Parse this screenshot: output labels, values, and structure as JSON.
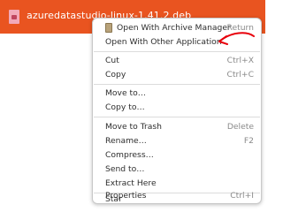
{
  "file": {
    "name": "azuredatastudio-linux-1.41.2.deb",
    "icon": "package-file-icon"
  },
  "menu": {
    "items": [
      {
        "label": "Open With Archive Manager",
        "shortcut": "Return",
        "icon": "archive-manager-icon"
      },
      {
        "label": "Open With Other Application",
        "shortcut": ""
      },
      {
        "label": "Cut",
        "shortcut": "Ctrl+X"
      },
      {
        "label": "Copy",
        "shortcut": "Ctrl+C"
      },
      {
        "label": "Move to…",
        "shortcut": ""
      },
      {
        "label": "Copy to…",
        "shortcut": ""
      },
      {
        "label": "Move to Trash",
        "shortcut": "Delete"
      },
      {
        "label": "Rename…",
        "shortcut": "F2"
      },
      {
        "label": "Compress…",
        "shortcut": ""
      },
      {
        "label": "Send to…",
        "shortcut": ""
      },
      {
        "label": "Extract Here",
        "shortcut": ""
      },
      {
        "label": "Star",
        "shortcut": ""
      },
      {
        "label": "Properties",
        "shortcut": "Ctrl+I"
      }
    ]
  },
  "colors": {
    "selection": "#e95420",
    "annotation_arrow": "#e8000b"
  }
}
